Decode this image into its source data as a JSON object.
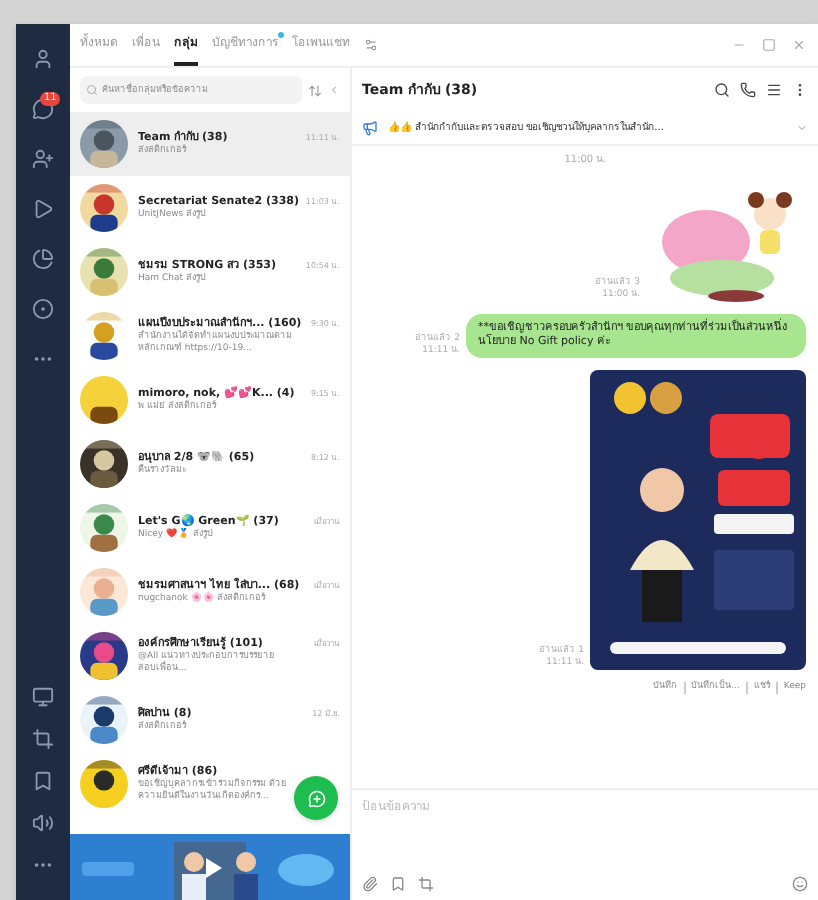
{
  "sidebar": {
    "items": [
      {
        "kind": "friends"
      },
      {
        "kind": "chats",
        "badge": "11"
      },
      {
        "kind": "add-friend"
      },
      {
        "kind": "voom"
      },
      {
        "kind": "news"
      },
      {
        "kind": "openchat"
      },
      {
        "kind": "more"
      }
    ],
    "bottom_items": [
      {
        "kind": "screen"
      },
      {
        "kind": "crop"
      },
      {
        "kind": "keep"
      },
      {
        "kind": "speaker"
      },
      {
        "kind": "dots"
      }
    ]
  },
  "tabs": [
    {
      "label": "ทั้งหมด",
      "selected": false,
      "dot": false
    },
    {
      "label": "เพื่อน",
      "selected": false,
      "dot": false
    },
    {
      "label": "กลุ่ม",
      "selected": true,
      "dot": false
    },
    {
      "label": "บัญชีทางการ",
      "selected": false,
      "dot": true
    },
    {
      "label": "โอเพนแชท",
      "selected": false,
      "dot": false
    }
  ],
  "search": {
    "placeholder": "ค้นหาชื่อกลุ่มหรือข้อความ"
  },
  "chats": [
    {
      "name": "Team กำกับ (38)",
      "preview": "ส่งสติกเกอร์",
      "time": "11:11 น.",
      "selected": true
    },
    {
      "name": "Secretariat Senate2 (338)",
      "preview": "UnitJNews ส่งรูป",
      "time": "11:03 น.",
      "selected": false
    },
    {
      "name": "ชมรม STRONG สว (353)",
      "preview": "Ham Chat ส่งรูป",
      "time": "10:54 น.",
      "selected": false
    },
    {
      "name": "แผนปีงบประมาณสำนักฯ... (160)",
      "preview": "สำนักงานได้จัดทำแผนงบประมาณตามหลักเกณฑ์ https://10-19...",
      "time": "9:30 น.",
      "selected": false
    },
    {
      "name": "mimoro, nok, 💕💕K... (4)",
      "preview": "พ แม่ย่ ส่งสติกเกอร์",
      "time": "9:15 น.",
      "selected": false
    },
    {
      "name": "อนุบาล 2/8 🐨🐘 (65)",
      "preview": "คืนรางวัลมะ",
      "time": "8:12 น.",
      "selected": false
    },
    {
      "name": "Let's G🌏 Green🌱 (37)",
      "preview": "Nicey ❤️🏅 ส่งรูป",
      "time": "เมื่อวาน",
      "selected": false
    },
    {
      "name": "ชมรมศาสนาฯ ไทย ใส่บา... (68)",
      "preview": "nugchanok 🌸🌸 ส่งสติกเกอร์",
      "time": "เมื่อวาน",
      "selected": false
    },
    {
      "name": "องค์กรศึกษาเรียนรู้ (101)",
      "preview": "@All แนวทางประกอบการบรรยายสอบเพื่อน...",
      "time": "เมื่อวาน",
      "selected": false
    },
    {
      "name": "ศิลปาน (8)",
      "preview": "ส่งสติกเกอร์",
      "time": "12 มิ.ย.",
      "selected": false
    },
    {
      "name": "ศรีดีเจ้ามา (86)",
      "preview": "ขอเชิญบุคลากรเข้าร่วมกิจกรรม ด้วยความยินดีในงานวันเกิดองค์กร...",
      "selected": false
    }
  ],
  "chat": {
    "title": "Team กำกับ (38)",
    "announcement": "👍👍 สำนักกำกับและตรวจสอบ ขอเชิญชวนให้บุคลากรในสำนัก...",
    "messages": [
      {
        "kind": "time",
        "text": "11:00 น."
      },
      {
        "kind": "sticker",
        "read": "อ่านแล้ว 3",
        "time": "11:00 น."
      },
      {
        "kind": "text",
        "read": "อ่านแล้ว 2",
        "time": "11:11 น.",
        "text": "**ขอเชิญชาวครอบครัวสำนักฯ ขอบคุณทุกท่านที่ร่วมเป็นส่วนหนึ่งนโยบาย No Gift policy ค่ะ"
      },
      {
        "read": "อ่านแล้ว 1",
        "time": "11:11 น."
      }
    ],
    "image_actions": [
      "บันทึก",
      "บันทึกเป็น...",
      "แชร์",
      "Keep"
    ],
    "input": {
      "placeholder": "ป้อนข้อความ"
    }
  }
}
